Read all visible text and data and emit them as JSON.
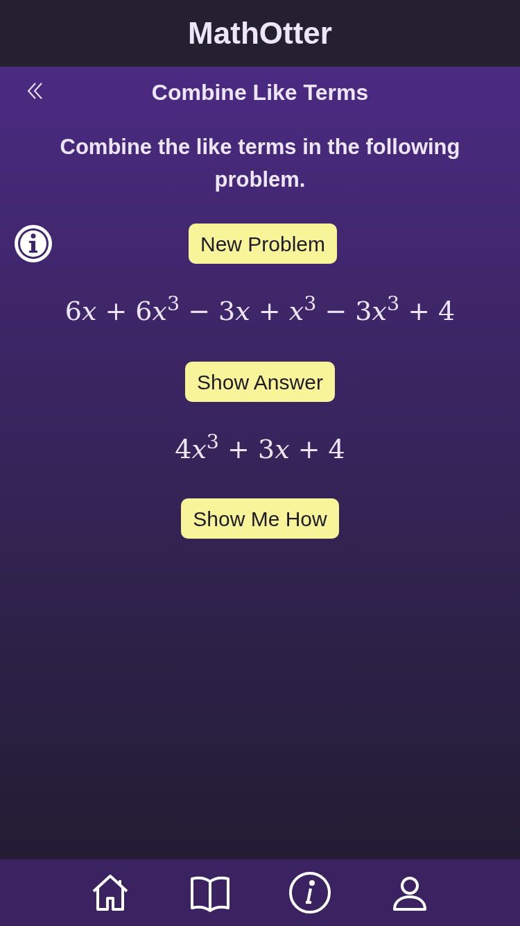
{
  "app": {
    "title": "MathOtter"
  },
  "page": {
    "title": "Combine Like Terms"
  },
  "instruction": "Combine the like terms in the following problem.",
  "problem_button": "New Problem",
  "problem": "6𝑥 + 6𝑥$^{3}$ − 3𝑥 + 𝑥$^{3}$ − 3𝑥$^{3}$ + 4",
  "answer_button": "Show Answer",
  "answer": "4𝑥$^{3}$ + 3𝑥 + 4",
  "how_button": "Show Me How",
  "nav": [
    {
      "kind": "home"
    },
    {
      "kind": "book"
    },
    {
      "kind": "info"
    },
    {
      "kind": "profile"
    }
  ]
}
